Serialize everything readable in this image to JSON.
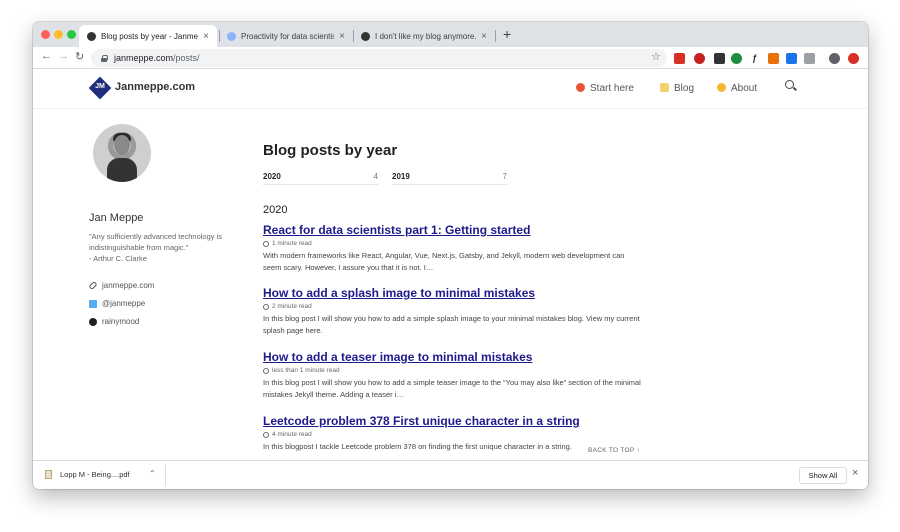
{
  "browser": {
    "tabs": [
      {
        "title": "Blog posts by year - Janmeppe.com",
        "active": true
      },
      {
        "title": "Proactivity for data scientists",
        "active": false
      },
      {
        "title": "I don't like my blog anymore. H",
        "active": false
      }
    ],
    "new_tab": "+",
    "url_host": "janmeppe.com",
    "url_path": "/posts/"
  },
  "site": {
    "logo_text": "JM",
    "title": "Janmeppe.com",
    "nav": [
      {
        "label": "Start here"
      },
      {
        "label": "Blog"
      },
      {
        "label": "About"
      }
    ]
  },
  "author": {
    "name": "Jan Meppe",
    "bio": "\"Any sufficiently advanced technology is indistinguishable from magic.\"",
    "bio_attr": "- Arthur C. Clarke",
    "links": [
      {
        "label": "janmeppe.com",
        "icon": "link-icon"
      },
      {
        "label": "@janmeppe",
        "icon": "twitter-icon"
      },
      {
        "label": "rainymood",
        "icon": "github-icon"
      }
    ]
  },
  "main": {
    "heading": "Blog posts by year",
    "years": [
      {
        "year": "2020",
        "count": "4"
      },
      {
        "year": "2019",
        "count": "7"
      }
    ],
    "section_year": "2020",
    "posts": [
      {
        "title": "React for data scientists part 1: Getting started",
        "read": "1 minute read",
        "excerpt": "With modern frameworks like React, Angular, Vue, Next.js, Gatsby, and Jekyll, modern web development can seem scary. However, I assure you that it is not. I…"
      },
      {
        "title": "How to add a splash image to minimal mistakes",
        "read": "2 minute read",
        "excerpt": "In this blog post I will show you how to add a simple splash image to your minimal mistakes blog. View my current splash page here."
      },
      {
        "title": "How to add a teaser image to minimal mistakes",
        "read": "less than 1 minute read",
        "excerpt": "In this blog post I will show you how to add a simple teaser image to the “You may also like” section of the minimal mistakes Jekyll theme. Adding a teaser i…"
      },
      {
        "title": "Leetcode problem 378 First unique character in a string",
        "read": "4 minute read",
        "excerpt": "In this blogpost I tackle Leetcode problem 378 on finding the first unique character in a string."
      }
    ],
    "back_to_top": "BACK TO TOP ↑"
  },
  "downloads": {
    "file": "Lopp M - Being....pdf",
    "show_all": "Show All"
  }
}
